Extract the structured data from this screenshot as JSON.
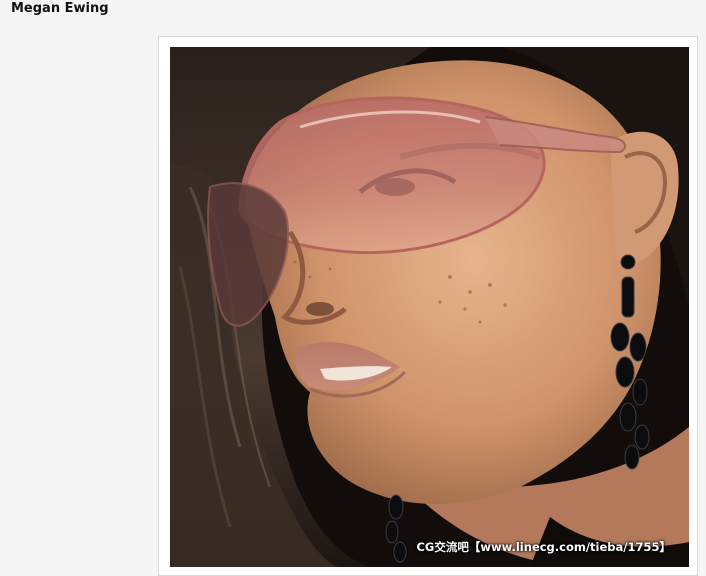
{
  "post": {
    "author": "Megan Ewing",
    "image": {
      "subject": "portrait-woman-sunglasses",
      "watermark": "CG交流吧【www.linecg.com/tieba/1755】"
    }
  },
  "colors": {
    "page_bg": "#f5f5f5",
    "frame_bg": "#ffffff",
    "frame_border": "#d9d9d9",
    "lens_tint": "#c97a72",
    "skin": "#d9a07a"
  }
}
